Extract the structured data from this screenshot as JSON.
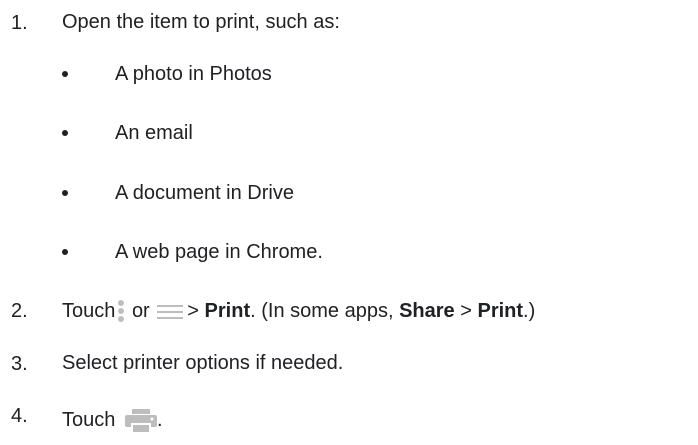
{
  "steps": [
    {
      "number": "1.",
      "text": "Open the item to print, such as:",
      "subitems": [
        "A photo in Photos",
        "An email",
        "A document in Drive",
        "A web page in Chrome."
      ]
    },
    {
      "number": "2.",
      "part1": "Touch",
      "part2": "or",
      "part3": ">",
      "print1": "Print",
      "part4": ". (In some apps,",
      "share": "Share",
      "part5": ">",
      "print2": "Print",
      "part6": ".)",
      "icons": [
        "more-vert-icon",
        "menu-icon"
      ]
    },
    {
      "number": "3.",
      "text": "Select printer options if needed."
    },
    {
      "number": "4.",
      "part1": "Touch",
      "part2": ".",
      "icon": "printer-icon"
    }
  ],
  "colors": {
    "text": "#202124",
    "icon": "#bdbdbd"
  }
}
